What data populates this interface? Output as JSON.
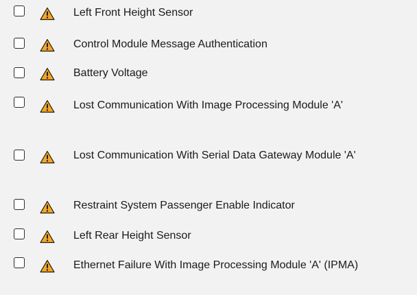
{
  "items": [
    {
      "label": "Left Front Height Sensor",
      "checked": false,
      "icon": "warning-icon"
    },
    {
      "label": "Control Module Message Authentication",
      "checked": false,
      "icon": "warning-icon"
    },
    {
      "label": "Battery Voltage",
      "checked": false,
      "icon": "warning-icon"
    },
    {
      "label": "Lost Communication With Image Processing Module 'A'",
      "checked": false,
      "icon": "warning-icon"
    },
    {
      "label": "Lost Communication With Serial Data Gateway Module 'A'",
      "checked": false,
      "icon": "warning-icon"
    },
    {
      "label": "Restraint System Passenger Enable Indicator",
      "checked": false,
      "icon": "warning-icon"
    },
    {
      "label": "Left Rear Height Sensor",
      "checked": false,
      "icon": "warning-icon"
    },
    {
      "label": "Ethernet Failure With Image Processing Module 'A' (IPMA)",
      "checked": false,
      "icon": "warning-icon"
    }
  ],
  "colors": {
    "background": "#f2f2f2",
    "warning_fill": "#f5a623",
    "warning_mark": "#1a1a1a",
    "checkbox_border": "#2b2b2b"
  }
}
